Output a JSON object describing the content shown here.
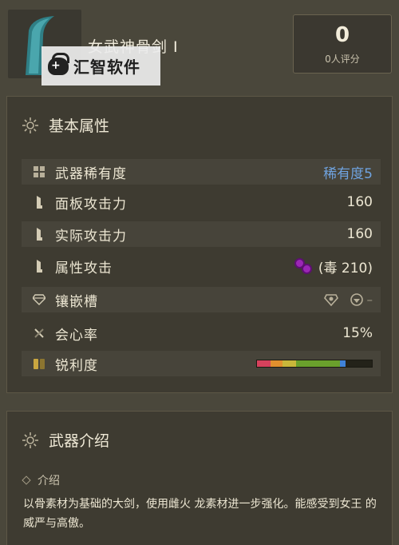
{
  "header": {
    "weapon_name": "女武神骨剑 Ⅰ",
    "watermark": "汇智软件",
    "rating": {
      "value": "0",
      "label": "0人评分"
    }
  },
  "attributes": {
    "title": "基本属性",
    "rows": [
      {
        "icon": "grid-icon",
        "label": "武器稀有度",
        "value": "稀有度5"
      },
      {
        "icon": "blade-icon",
        "label": "面板攻击力",
        "value": "160"
      },
      {
        "icon": "blade-icon",
        "label": "实际攻击力",
        "value": "160"
      },
      {
        "icon": "blade-icon",
        "label": "属性攻击",
        "value": "(毒 210)"
      },
      {
        "icon": "gem-icon",
        "label": "镶嵌槽",
        "value": "–"
      },
      {
        "icon": "crossed-swords-icon",
        "label": "会心率",
        "value": "15%"
      },
      {
        "icon": "whetstone-icon",
        "label": "锐利度",
        "value": ""
      }
    ],
    "element_color": "#9b27b5",
    "rarity_color": "#6fa3e0",
    "sharpness": [
      {
        "color": "#d6415c",
        "fraction": 0.12
      },
      {
        "color": "#e2902e",
        "fraction": 0.1
      },
      {
        "color": "#c9b73a",
        "fraction": 0.12
      },
      {
        "color": "#6aa02c",
        "fraction": 0.38
      },
      {
        "color": "#3f82d8",
        "fraction": 0.05
      },
      {
        "color": "#232219",
        "fraction": 0.23
      }
    ]
  },
  "intro": {
    "title": "武器介绍",
    "subtitle": "介绍",
    "text": "以骨素材为基础的大剑，使用雌火 龙素材进一步强化。能感受到女王 的威严与高傲。"
  }
}
